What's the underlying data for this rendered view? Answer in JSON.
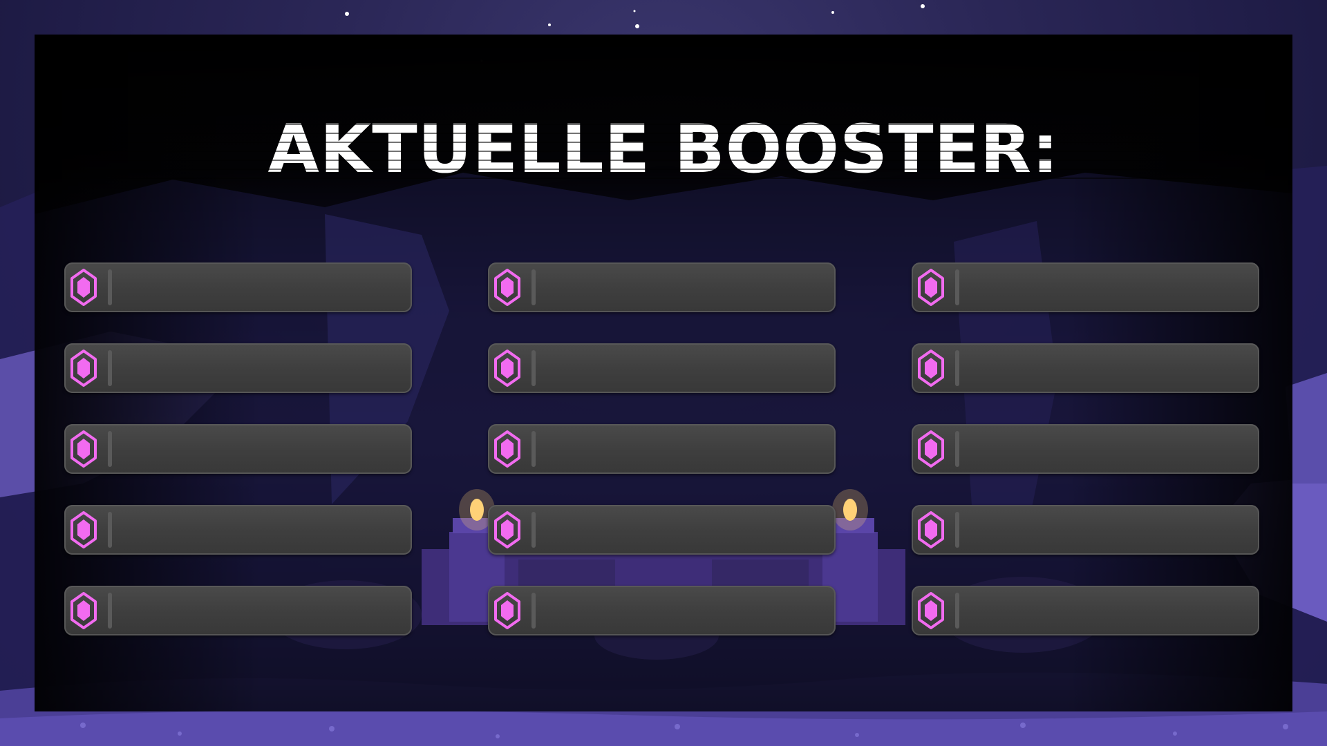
{
  "title": "AKTUELLE BOOSTER:",
  "colors": {
    "accent": "#f26bf0",
    "slot_background": "#404040",
    "panel": "#000000",
    "title": "#ffffff"
  },
  "booster_slots": {
    "icon": "pink-gem-icon",
    "columns": [
      {
        "slots": [
          {
            "text": ""
          },
          {
            "text": ""
          },
          {
            "text": ""
          },
          {
            "text": ""
          },
          {
            "text": ""
          }
        ]
      },
      {
        "slots": [
          {
            "text": ""
          },
          {
            "text": ""
          },
          {
            "text": ""
          },
          {
            "text": ""
          },
          {
            "text": ""
          }
        ]
      },
      {
        "slots": [
          {
            "text": ""
          },
          {
            "text": ""
          },
          {
            "text": ""
          },
          {
            "text": ""
          },
          {
            "text": ""
          }
        ]
      }
    ]
  }
}
